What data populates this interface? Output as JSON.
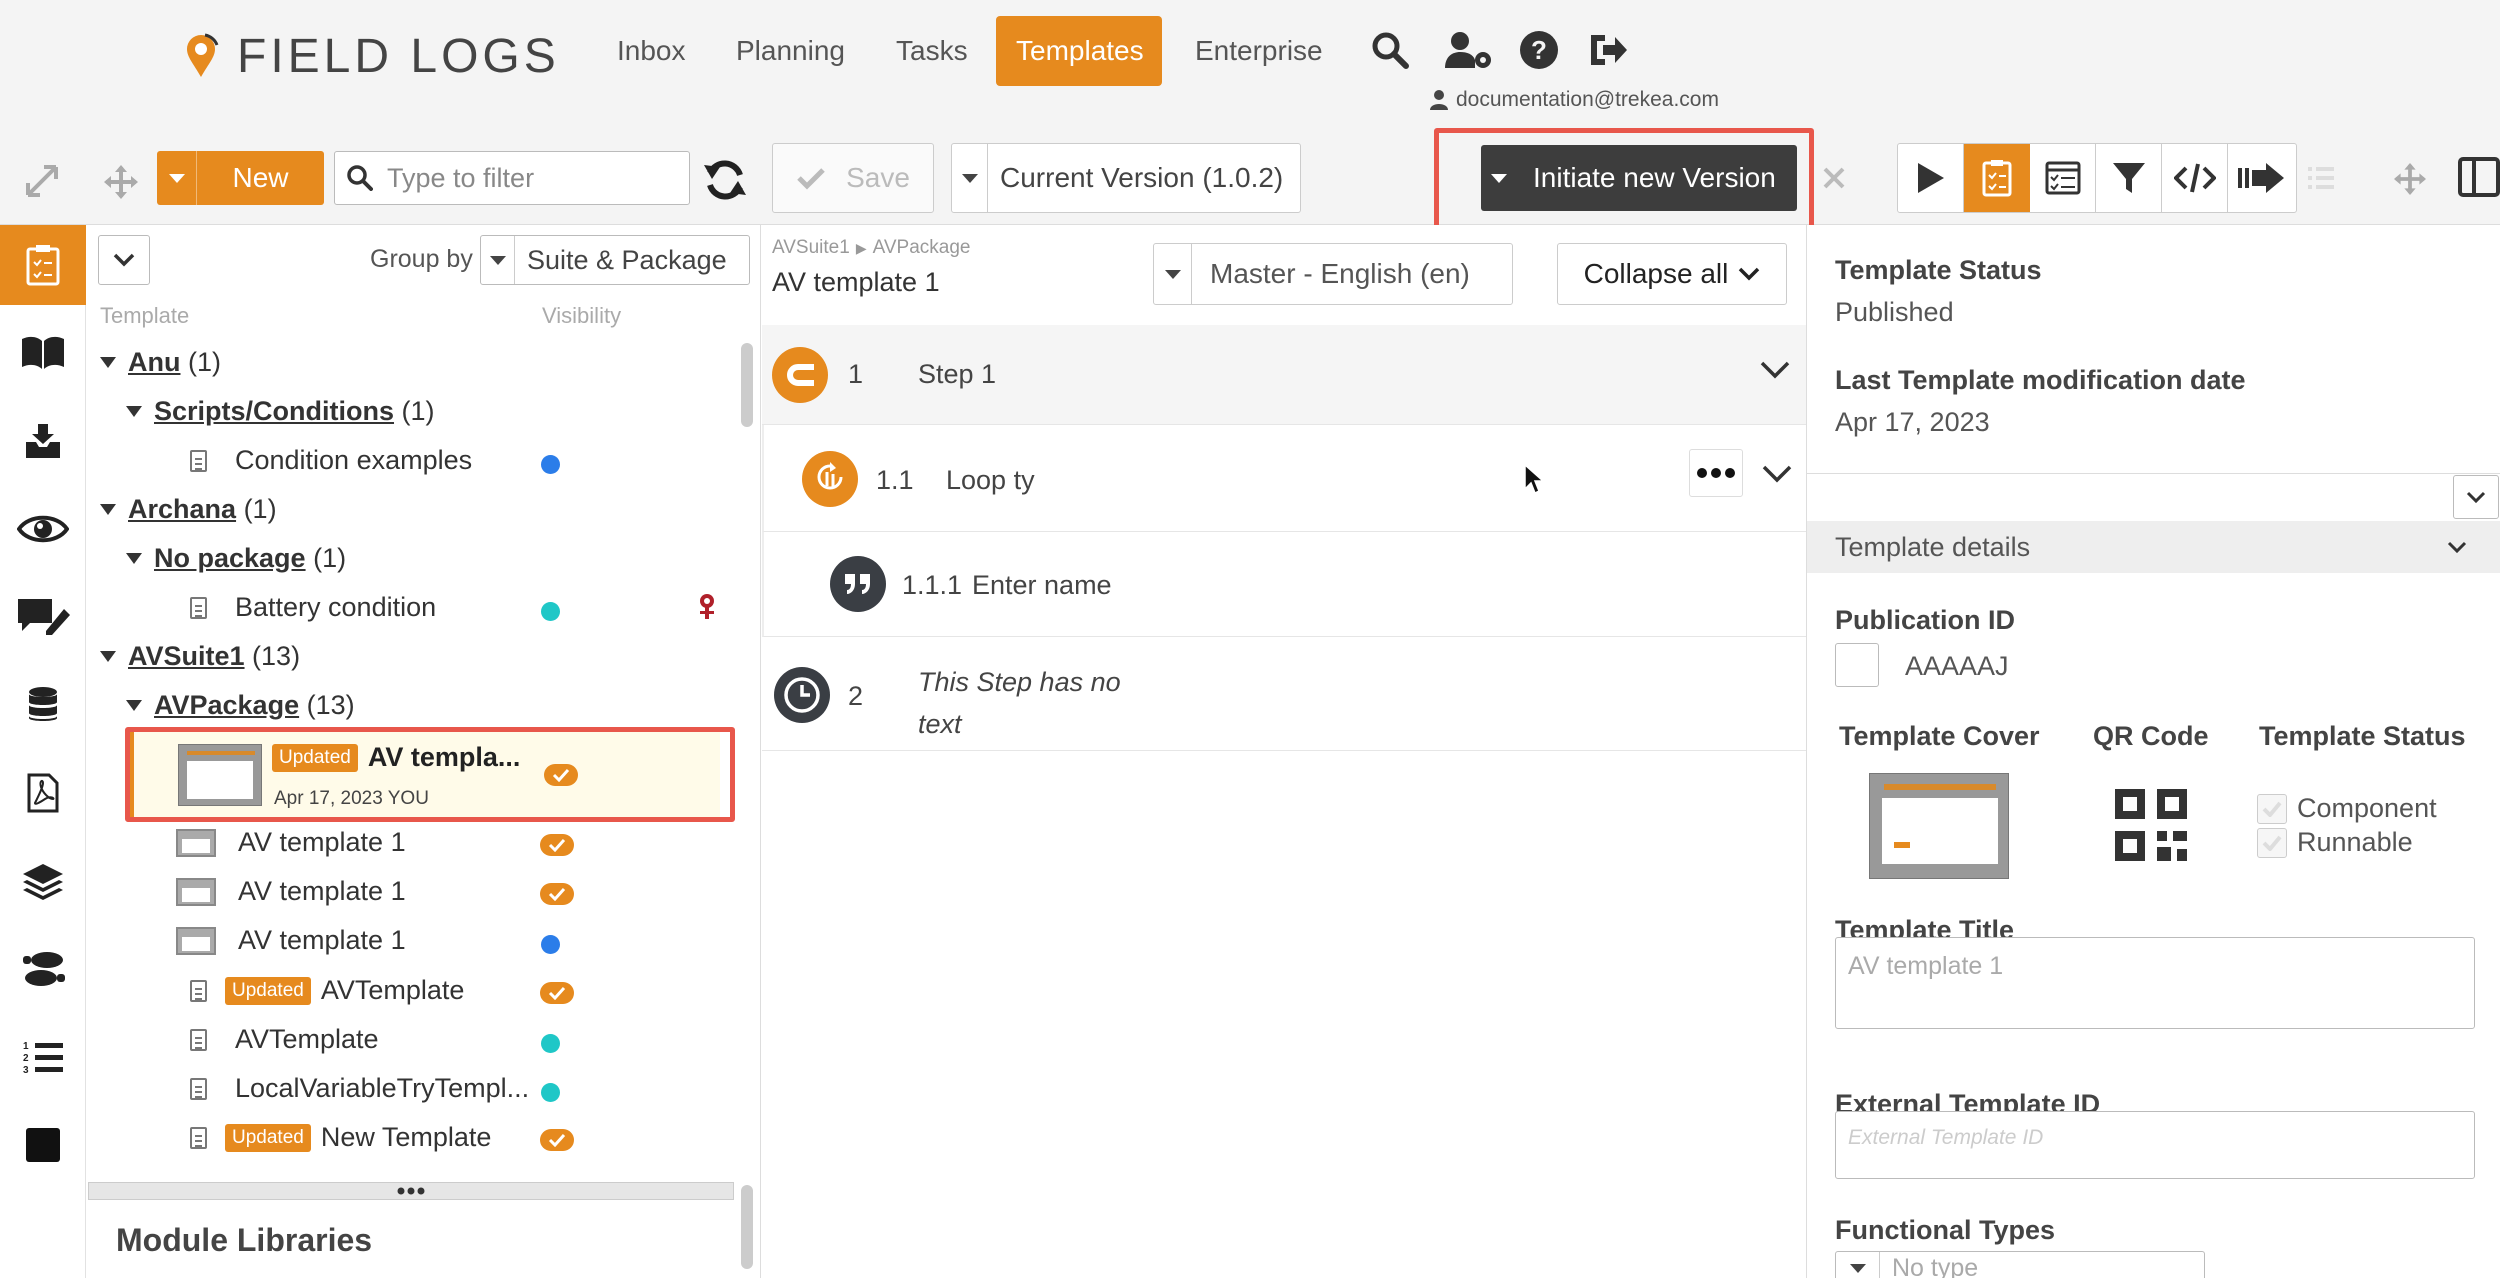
{
  "app": {
    "logo_text": "FIELD LOGS",
    "accent": "#e68a1e",
    "highlight": "#e8574b"
  },
  "nav": {
    "items": [
      "Inbox",
      "Planning",
      "Tasks",
      "Templates",
      "Enterprise"
    ],
    "active": "Templates",
    "icons": [
      "search-icon",
      "user-settings-icon",
      "help-icon",
      "logout-icon"
    ],
    "user_email": "documentation@trekea.com"
  },
  "left_toolbar": {
    "new_label": "New",
    "filter_placeholder": "Type to filter",
    "group_by_label": "Group by",
    "group_by_value": "Suite & Package",
    "col_template": "Template",
    "col_visibility": "Visibility"
  },
  "tree": [
    {
      "type": "group",
      "name": "Anu",
      "count": "(1)"
    },
    {
      "type": "sub",
      "name": "Scripts/Conditions",
      "count": "(1)"
    },
    {
      "type": "item",
      "name": "Condition examples",
      "dot": "blue"
    },
    {
      "type": "group",
      "name": "Archana",
      "count": "(1)"
    },
    {
      "type": "sub",
      "name": "No package",
      "count": "(1)"
    },
    {
      "type": "item",
      "name": "Battery condition",
      "dot": "teal"
    },
    {
      "type": "group",
      "name": "AVSuite1",
      "count": "(13)"
    },
    {
      "type": "sub",
      "name": "AVPackage",
      "count": "(13)"
    },
    {
      "type": "selected",
      "badge": "Updated",
      "name": "AV templa...",
      "meta": "Apr 17, 2023  YOU"
    },
    {
      "type": "thumbitem",
      "name": "AV template 1",
      "status": "check"
    },
    {
      "type": "thumbitem",
      "name": "AV template 1",
      "status": "check"
    },
    {
      "type": "thumbitem",
      "name": "AV template 1",
      "status": "blue"
    },
    {
      "type": "item",
      "name": "AVTemplate",
      "badge": "Updated",
      "status": "check"
    },
    {
      "type": "item",
      "name": "AVTemplate",
      "status": "teal"
    },
    {
      "type": "item",
      "name": "LocalVariableTryTempl...",
      "status": "teal"
    },
    {
      "type": "item",
      "name": "New Template",
      "badge": "Updated",
      "status": "check"
    }
  ],
  "module_libraries": "Module Libraries",
  "editor": {
    "save_label": "Save",
    "version_value": "Current Version (1.0.2)",
    "initiate_label": "Initiate new Version",
    "breadcrumb_suite": "AVSuite1",
    "breadcrumb_package": "AVPackage",
    "template_name": "AV template 1",
    "language_value": "Master - English (en)",
    "collapse_label": "Collapse all",
    "steps": [
      {
        "num": "1",
        "label": "Step 1"
      },
      {
        "num": "1.1",
        "label": "Loop ty"
      },
      {
        "num": "1.1.1",
        "label": "Enter name"
      },
      {
        "num": "2",
        "label_line1": "This Step has no",
        "label_line2": "text"
      }
    ]
  },
  "details": {
    "status_label": "Template Status",
    "status_value": "Published",
    "modified_label": "Last Template modification date",
    "modified_value": "Apr 17, 2023",
    "section_title": "Template details",
    "pubid_label": "Publication ID",
    "pubid_value": "AAAAAJ",
    "cover_label": "Template Cover",
    "qr_label": "QR Code",
    "tstatus_label": "Template Status",
    "component_label": "Component",
    "runnable_label": "Runnable",
    "title_label": "Template Title",
    "title_placeholder": "AV template 1",
    "extid_label": "External Template ID",
    "extid_placeholder": "External Template ID",
    "functypes_label": "Functional Types",
    "functypes_placeholder": "No type"
  }
}
